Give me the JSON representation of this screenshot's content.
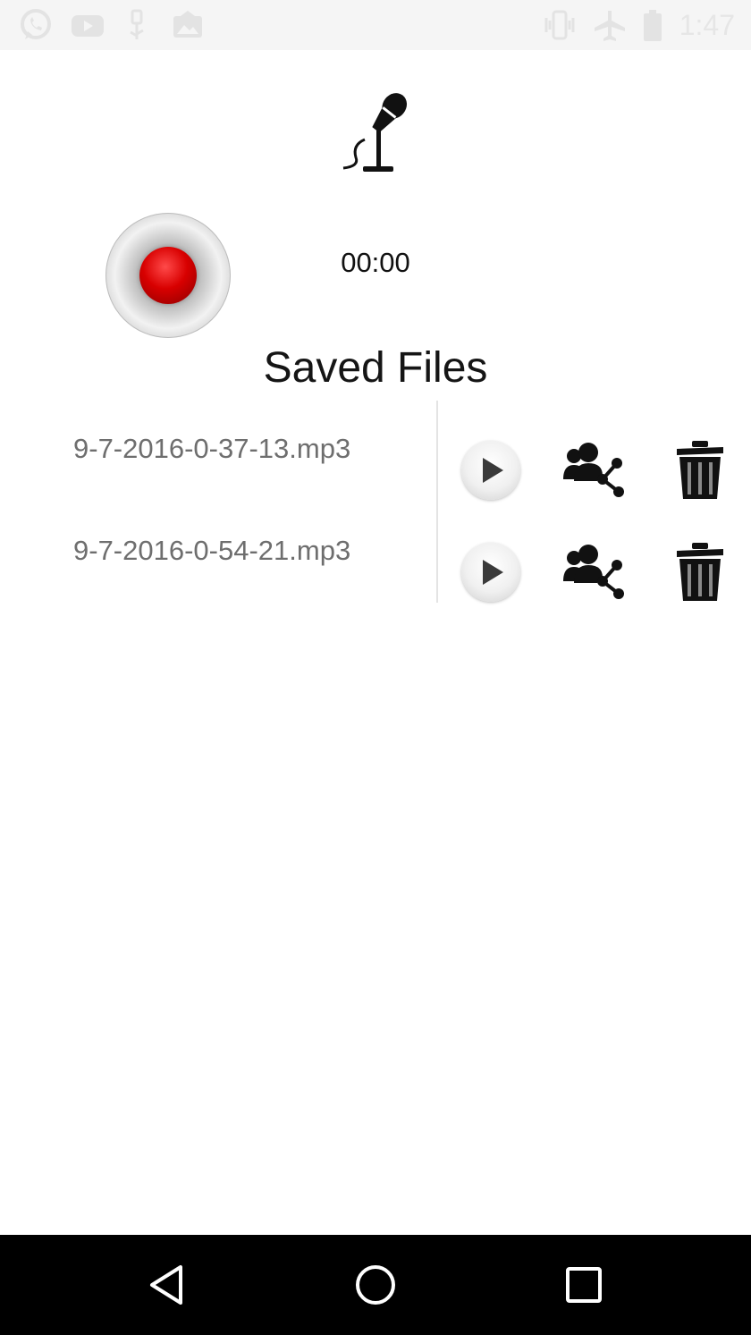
{
  "status_bar": {
    "icons": [
      "whatsapp-icon",
      "youtube-icon",
      "usb-debug-icon",
      "photo-icon",
      "vibrate-icon",
      "airplane-icon",
      "battery-icon"
    ],
    "time": "1:47"
  },
  "recorder": {
    "mic_icon": "microphone-icon",
    "timer": "00:00"
  },
  "saved_files": {
    "title": "Saved Files",
    "files": [
      {
        "name": "9-7-2016-0-37-13.mp3"
      },
      {
        "name": "9-7-2016-0-54-21.mp3"
      }
    ]
  },
  "nav_bar": {
    "icons": [
      "back-icon",
      "home-icon",
      "recents-icon"
    ]
  },
  "colors": {
    "record_red": "#d80000",
    "file_name_gray": "#6e6e6e",
    "nav_background": "#000000"
  }
}
